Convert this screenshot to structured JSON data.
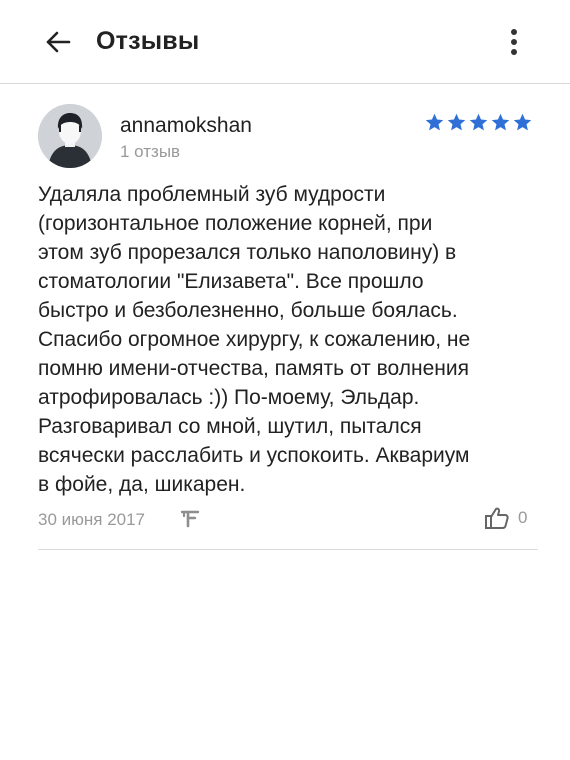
{
  "header": {
    "title": "Отзывы",
    "back_icon": "arrow-left-icon",
    "menu_icon": "more-vertical-icon"
  },
  "review": {
    "username": "annamokshan",
    "reviews_count": "1 отзыв",
    "rating": 5,
    "max_rating": 5,
    "star_color": "#2f6fd6",
    "text": "Удаляла проблемный зуб мудрости\n(горизонтальное положение корней, при\nэтом зуб прорезался только наполовину) в\nстоматологии \"Елизавета\". Все прошло\nбыстро и безболезненно, больше боялась.\nСпасибо огромное хирургу, к сожалению, не\nпомню имени-отчества, память от волнения\nатрофировалась :)) По-моему, Эльдар.\nРазговаривал со мной, шутил, пытался\nвсячески расслабить и успокоить. Аквариум\nв фойе, да, шикарен.",
    "date": "30 июня 2017",
    "source_icon": "flamp-logo-icon",
    "likes": "0",
    "like_icon": "thumbs-up-icon"
  }
}
